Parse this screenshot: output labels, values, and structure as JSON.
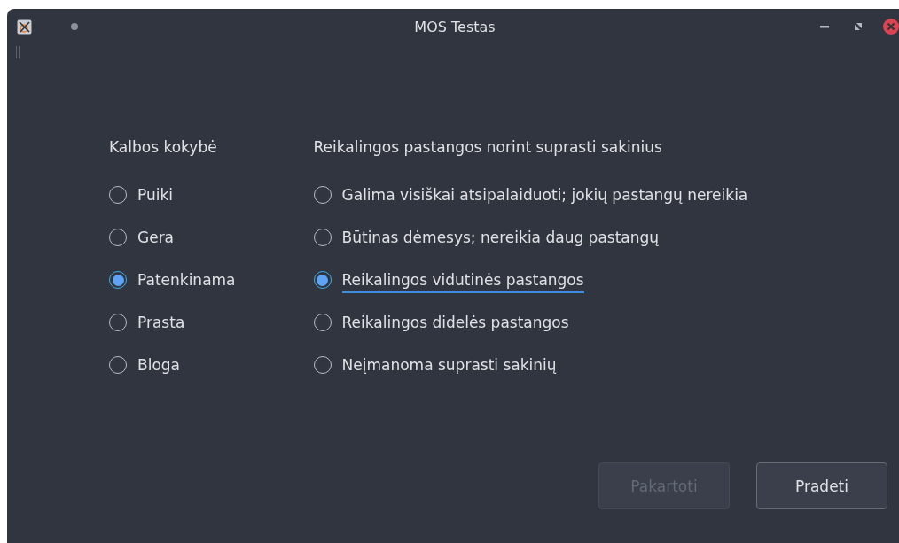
{
  "window": {
    "title": "MOS Testas"
  },
  "groups": [
    {
      "title": "Kalbos kokybė",
      "options": [
        {
          "label": "Puiki",
          "selected": false,
          "focused": false
        },
        {
          "label": "Gera",
          "selected": false,
          "focused": false
        },
        {
          "label": "Patenkinama",
          "selected": true,
          "focused": false
        },
        {
          "label": "Prasta",
          "selected": false,
          "focused": false
        },
        {
          "label": "Bloga",
          "selected": false,
          "focused": false
        }
      ]
    },
    {
      "title": "Reikalingos pastangos norint suprasti sakinius",
      "options": [
        {
          "label": "Galima visiškai atsipalaiduoti; jokių pastangų nereikia",
          "selected": false,
          "focused": false
        },
        {
          "label": "Būtinas dėmesys; nereikia daug pastangų",
          "selected": false,
          "focused": false
        },
        {
          "label": "Reikalingos vidutinės pastangos",
          "selected": true,
          "focused": true
        },
        {
          "label": "Reikalingos didelės pastangos",
          "selected": false,
          "focused": false
        },
        {
          "label": "Neįmanoma suprasti sakinių",
          "selected": false,
          "focused": false
        }
      ]
    }
  ],
  "buttons": [
    {
      "label": "Pakartoti",
      "disabled": true
    },
    {
      "label": "Pradeti",
      "disabled": false
    }
  ]
}
